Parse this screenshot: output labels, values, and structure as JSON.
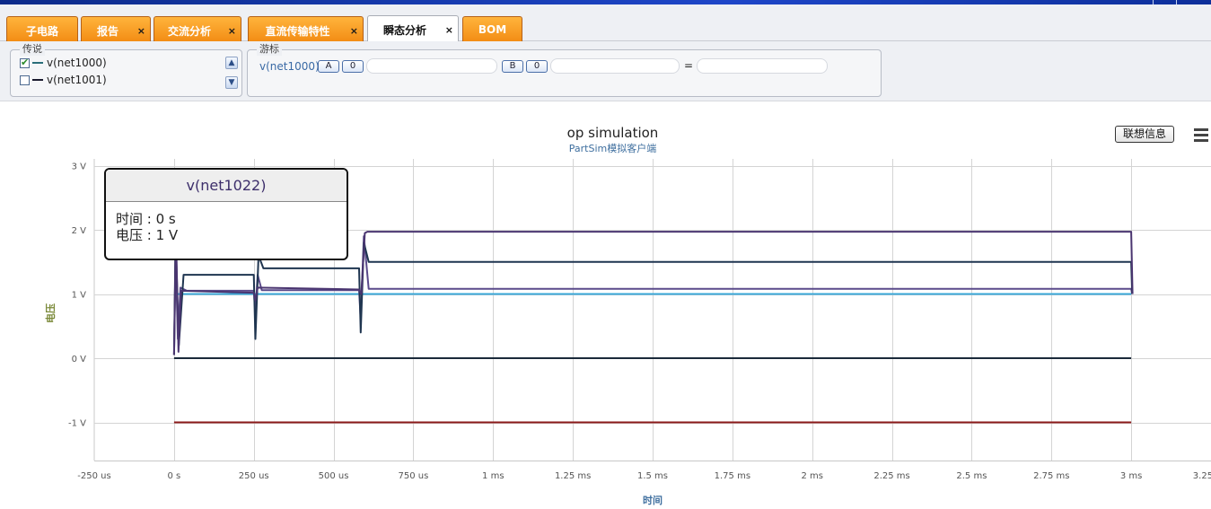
{
  "tabs": [
    {
      "label": "子电路",
      "closable": false,
      "active": false
    },
    {
      "label": "报告",
      "closable": true,
      "active": false
    },
    {
      "label": "交流分析",
      "closable": true,
      "active": false
    },
    {
      "label": "直流传输特性",
      "closable": true,
      "active": false
    },
    {
      "label": "瞬态分析",
      "closable": true,
      "active": true
    },
    {
      "label": "BOM",
      "closable": false,
      "active": false
    }
  ],
  "close_glyph": "×",
  "legend_panel": {
    "title": "传说",
    "items": [
      {
        "label": "v(net1000)",
        "checked": true,
        "color": "#2a6e7a"
      },
      {
        "label": "v(net1001)",
        "checked": false,
        "color": "#1a1a2e"
      }
    ],
    "scroll_up": "▲",
    "scroll_down": "▼"
  },
  "cursor_panel": {
    "title": "游标",
    "signal": "v(net1000)",
    "a_label": "A",
    "b_label": "B",
    "small_btn": "0",
    "equals": "="
  },
  "chart_data": {
    "type": "line",
    "title": "op simulation",
    "subtitle": "PartSim模拟客户端",
    "xlabel": "时间",
    "ylabel": "电压",
    "xlim": [
      -250,
      3250
    ],
    "ylim": [
      -1.4,
      3
    ],
    "x_unit": "us",
    "x_ticks": [
      {
        "v": -250,
        "label": "-250 us"
      },
      {
        "v": 0,
        "label": "0 s"
      },
      {
        "v": 250,
        "label": "250 us"
      },
      {
        "v": 500,
        "label": "500 us"
      },
      {
        "v": 750,
        "label": "750 us"
      },
      {
        "v": 1000,
        "label": "1 ms"
      },
      {
        "v": 1250,
        "label": "1.25 ms"
      },
      {
        "v": 1500,
        "label": "1.5 ms"
      },
      {
        "v": 1750,
        "label": "1.75 ms"
      },
      {
        "v": 2000,
        "label": "2 ms"
      },
      {
        "v": 2250,
        "label": "2.25 ms"
      },
      {
        "v": 2500,
        "label": "2.5 ms"
      },
      {
        "v": 2750,
        "label": "2.75 ms"
      },
      {
        "v": 3000,
        "label": "3 ms"
      },
      {
        "v": 3250,
        "label": "3.25 ms"
      }
    ],
    "y_ticks": [
      {
        "v": 3,
        "label": "3 V"
      },
      {
        "v": 2,
        "label": "2 V"
      },
      {
        "v": 1,
        "label": "1 V"
      },
      {
        "v": 0,
        "label": "0 V"
      },
      {
        "v": -1,
        "label": "-1 V"
      }
    ],
    "grid": true,
    "series": [
      {
        "color": "#8b1a1a",
        "points": [
          [
            0,
            -1
          ],
          [
            3000,
            -1
          ]
        ]
      },
      {
        "color": "#1a2a3a",
        "points": [
          [
            0,
            0
          ],
          [
            3000,
            0
          ]
        ]
      },
      {
        "color": "#3aa8d8",
        "points": [
          [
            0,
            1.0
          ],
          [
            3000,
            1.0
          ]
        ]
      },
      {
        "color": "#5a4a8a",
        "points": [
          [
            0,
            0.05
          ],
          [
            5,
            1.7
          ],
          [
            12,
            0.3
          ],
          [
            20,
            1.1
          ],
          [
            40,
            1.05
          ],
          [
            250,
            1.05
          ],
          [
            255,
            0.7
          ],
          [
            262,
            1.3
          ],
          [
            275,
            1.06
          ],
          [
            580,
            1.06
          ],
          [
            585,
            0.6
          ],
          [
            595,
            1.9
          ],
          [
            610,
            1.08
          ],
          [
            3000,
            1.08
          ],
          [
            3003,
            1.0
          ]
        ]
      },
      {
        "color": "#1f3550",
        "points": [
          [
            0,
            0.05
          ],
          [
            5,
            1.9
          ],
          [
            15,
            0.2
          ],
          [
            30,
            1.3
          ],
          [
            250,
            1.3
          ],
          [
            255,
            0.3
          ],
          [
            265,
            1.6
          ],
          [
            280,
            1.4
          ],
          [
            580,
            1.4
          ],
          [
            585,
            0.4
          ],
          [
            595,
            1.8
          ],
          [
            610,
            1.5
          ],
          [
            3000,
            1.5
          ],
          [
            3003,
            1.0
          ]
        ]
      },
      {
        "color": "#4a3570",
        "points": [
          [
            0,
            0.05
          ],
          [
            6,
            2.0
          ],
          [
            14,
            0.1
          ],
          [
            22,
            1.05
          ],
          [
            250,
            1.02
          ],
          [
            255,
            0.9
          ],
          [
            262,
            1.1
          ],
          [
            580,
            1.07
          ],
          [
            587,
            1.0
          ],
          [
            598,
            1.95
          ],
          [
            606,
            1.97
          ],
          [
            3000,
            1.97
          ],
          [
            3004,
            1.0
          ]
        ]
      }
    ]
  },
  "assoc_button": "联想信息",
  "tooltip": {
    "header": "v(net1022)",
    "line1": "时间 : 0 s",
    "line2": "电压 : 1 V"
  }
}
